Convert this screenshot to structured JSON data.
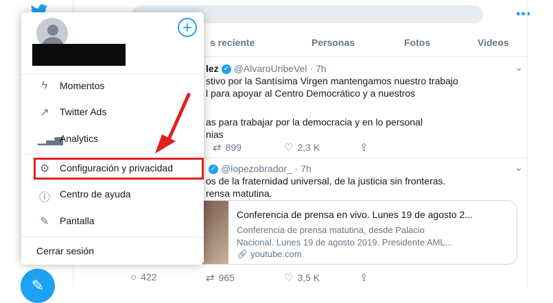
{
  "search": {
    "placeholder": ""
  },
  "tabs": [
    "s reciente",
    "Personas",
    "Fotos",
    "Videos"
  ],
  "menu": {
    "items": [
      {
        "label": "Momentos",
        "icon": "lightning-icon"
      },
      {
        "label": "Twitter Ads",
        "icon": "external-arrow-icon"
      },
      {
        "label": "Analytics",
        "icon": "bar-chart-icon"
      },
      {
        "label": "Configuración y privacidad",
        "icon": "gear-icon"
      },
      {
        "label": "Centro de ayuda",
        "icon": "help-icon"
      },
      {
        "label": "Pantalla",
        "icon": "edit-icon"
      }
    ],
    "logout": "Cerrar sesión"
  },
  "tweets": [
    {
      "name": "lez",
      "handle": "@AlvaroUribeVel",
      "time": "· 7h",
      "lines": [
        "stivo por la Santísima Virgen mantengamos nuestro trabajo",
        "l para apoyar al Centro Democrático y a nuestros",
        "as para trabajar por la democracia y en lo personal",
        "nias"
      ],
      "retweets": "899",
      "likes": "2,3 K"
    },
    {
      "handle": "@lopezobrador_",
      "time": "· 7h",
      "lines": [
        "os de la fraternidad universal, de la justicia sin fronteras.",
        "rensa matutina."
      ],
      "card": {
        "title": "Conferencia de prensa en vivo. Lunes 19 de agosto 2...",
        "desc1": "Conferencia de prensa matutina, desde Palacio",
        "desc2": "Nacional. Lunes 19 de agosto 2019. Presidente AML...",
        "link": "youtube.com"
      },
      "replies": "422",
      "retweets": "965",
      "likes": "3,5 K"
    }
  ],
  "colors": {
    "accent": "#1da1f2",
    "highlight": "#e0201f"
  }
}
